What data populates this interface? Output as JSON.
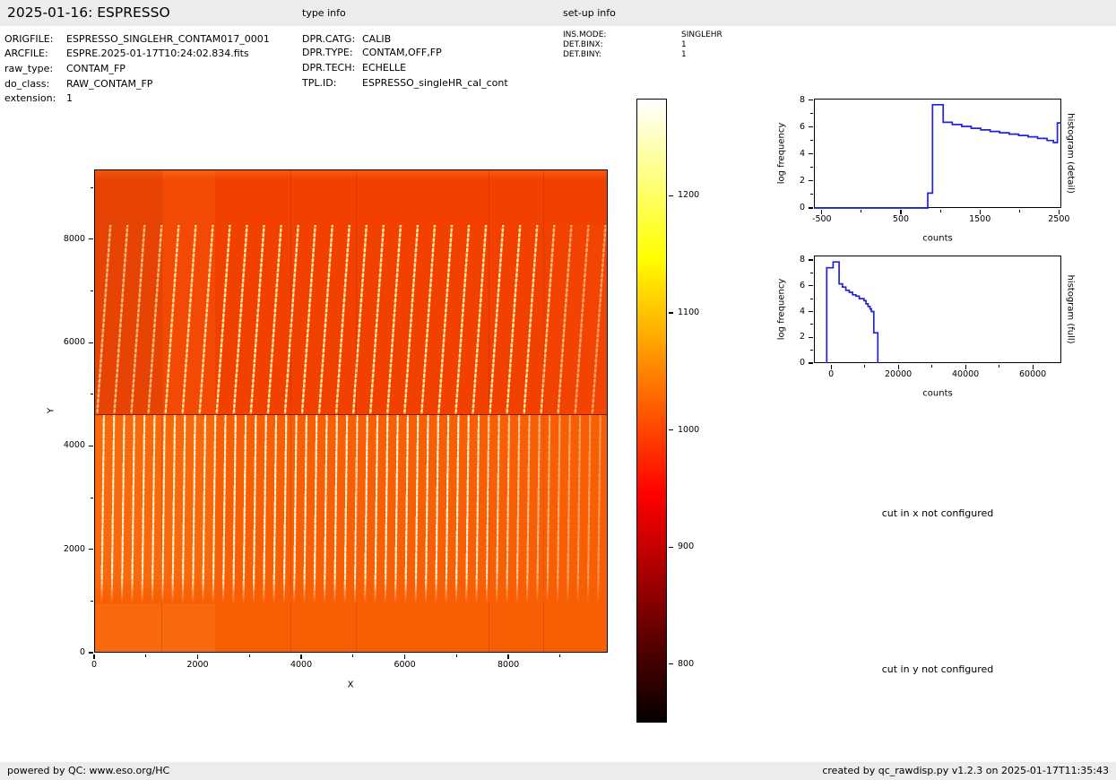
{
  "header": {
    "title": "2025-01-16: ESPRESSO",
    "type_info_label": "type info",
    "setup_info_label": "set-up info"
  },
  "file_info": {
    "rows": [
      {
        "label": "ORIGFILE:",
        "value": "ESPRESSO_SINGLEHR_CONTAM017_0001"
      },
      {
        "label": "ARCFILE:",
        "value": "ESPRE.2025-01-17T10:24:02.834.fits"
      },
      {
        "label": "raw_type:",
        "value": "CONTAM_FP"
      },
      {
        "label": "do_class:",
        "value": "RAW_CONTAM_FP"
      },
      {
        "label": "extension:",
        "value": "1"
      }
    ]
  },
  "type_info": {
    "rows": [
      {
        "label": "DPR.CATG:",
        "value": "CALIB"
      },
      {
        "label": "DPR.TYPE:",
        "value": "CONTAM,OFF,FP"
      },
      {
        "label": "DPR.TECH:",
        "value": "ECHELLE"
      },
      {
        "label": "TPL.ID:",
        "value": "ESPRESSO_singleHR_cal_cont"
      }
    ]
  },
  "setup_info": {
    "rows": [
      {
        "label": "INS.MODE:",
        "value": "SINGLEHR"
      },
      {
        "label": "DET.BINX:",
        "value": "1"
      },
      {
        "label": "DET.BINY:",
        "value": "1"
      }
    ]
  },
  "messages": {
    "cut_x": "cut in x not configured",
    "cut_y": "cut in y not configured"
  },
  "footer": {
    "left": "powered by QC: www.eso.org/HC",
    "right": "created by qc_rawdisp.py v1.2.3 on 2025-01-17T11:35:43"
  },
  "colors": {
    "hist_line": "#2222d8",
    "band_bg": "#ececec"
  },
  "chart_data": [
    {
      "type": "heatmap",
      "name": "raw-image-display",
      "xlabel": "X",
      "ylabel": "Y",
      "xlim": [
        0,
        9920
      ],
      "ylim": [
        0,
        9350
      ],
      "xticks": [
        0,
        2000,
        4000,
        6000,
        8000
      ],
      "xminor": [
        1000,
        3000,
        5000,
        7000,
        9000
      ],
      "yticks": [
        0,
        2000,
        4000,
        6000,
        8000
      ],
      "yminor": [
        1000,
        3000,
        5000,
        7000,
        9000
      ],
      "colormap": "hot",
      "image_features": {
        "echelle_order_stripes_y_range": [
          975,
          8330
        ],
        "detector_half_boundary_y": 4650,
        "upper_half_orders": "tilted dashed stripes, pitch ~330 px detector units",
        "lower_half_orders": "near-vertical bright stripes, brighter at left, dotted at right",
        "blank_top_band_y": [
          8330,
          9350
        ],
        "blank_bottom_band_y": [
          0,
          975
        ]
      }
    },
    {
      "type": "colorbar",
      "name": "colorbar",
      "vmin": 750,
      "vmax": 1283,
      "ticks": [
        800,
        900,
        1000,
        1100,
        1200
      ],
      "colormap": "hot"
    },
    {
      "type": "line",
      "name": "histogram-detail",
      "title_right": "histogram (detail)",
      "xlabel": "counts",
      "ylabel": "log frequency",
      "xlim": [
        -600,
        2530
      ],
      "ylim": [
        0,
        8.1
      ],
      "xticks": [
        -500,
        500,
        1500,
        2500
      ],
      "xminor": [
        0,
        1000,
        2000
      ],
      "yticks": [
        0,
        2,
        4,
        6,
        8
      ],
      "yminor": [
        1,
        3,
        5,
        7
      ],
      "steps": [
        [
          -600,
          0
        ],
        [
          840,
          0
        ],
        [
          840,
          1.1
        ],
        [
          900,
          1.1
        ],
        [
          900,
          7.65
        ],
        [
          1035,
          7.65
        ],
        [
          1035,
          6.35
        ],
        [
          1150,
          6.35
        ],
        [
          1150,
          6.18
        ],
        [
          1270,
          6.18
        ],
        [
          1270,
          6.04
        ],
        [
          1390,
          6.04
        ],
        [
          1390,
          5.9
        ],
        [
          1510,
          5.9
        ],
        [
          1510,
          5.78
        ],
        [
          1630,
          5.78
        ],
        [
          1630,
          5.67
        ],
        [
          1750,
          5.67
        ],
        [
          1750,
          5.57
        ],
        [
          1870,
          5.57
        ],
        [
          1870,
          5.47
        ],
        [
          1990,
          5.47
        ],
        [
          1990,
          5.37
        ],
        [
          2110,
          5.37
        ],
        [
          2110,
          5.27
        ],
        [
          2230,
          5.27
        ],
        [
          2230,
          5.15
        ],
        [
          2350,
          5.15
        ],
        [
          2350,
          5.0
        ],
        [
          2430,
          5.0
        ],
        [
          2430,
          4.85
        ],
        [
          2480,
          4.85
        ],
        [
          2480,
          6.3
        ],
        [
          2530,
          6.3
        ]
      ]
    },
    {
      "type": "line",
      "name": "histogram-full",
      "title_right": "histogram (full)",
      "xlabel": "counts",
      "ylabel": "log frequency",
      "xlim": [
        -5100,
        68500
      ],
      "ylim": [
        0,
        8.35
      ],
      "xticks": [
        0,
        20000,
        40000,
        60000
      ],
      "xminor": [
        10000,
        30000,
        50000
      ],
      "yticks": [
        0,
        2,
        4,
        6,
        8
      ],
      "yminor": [
        1,
        3,
        5,
        7
      ],
      "steps": [
        [
          -1300,
          0
        ],
        [
          -1300,
          7.4
        ],
        [
          600,
          7.4
        ],
        [
          600,
          7.85
        ],
        [
          2400,
          7.85
        ],
        [
          2400,
          6.15
        ],
        [
          3400,
          6.15
        ],
        [
          3400,
          5.9
        ],
        [
          4400,
          5.9
        ],
        [
          4400,
          5.65
        ],
        [
          5400,
          5.65
        ],
        [
          5400,
          5.5
        ],
        [
          6400,
          5.5
        ],
        [
          6400,
          5.3
        ],
        [
          7400,
          5.3
        ],
        [
          7400,
          5.2
        ],
        [
          8400,
          5.2
        ],
        [
          8400,
          5.0
        ],
        [
          9800,
          5.0
        ],
        [
          9800,
          4.85
        ],
        [
          10400,
          4.85
        ],
        [
          10400,
          4.6
        ],
        [
          11000,
          4.6
        ],
        [
          11000,
          4.4
        ],
        [
          11600,
          4.4
        ],
        [
          11600,
          4.2
        ],
        [
          12000,
          4.2
        ],
        [
          12000,
          4.0
        ],
        [
          12700,
          4.0
        ],
        [
          12700,
          2.35
        ],
        [
          13900,
          2.35
        ],
        [
          13900,
          0
        ]
      ]
    }
  ]
}
